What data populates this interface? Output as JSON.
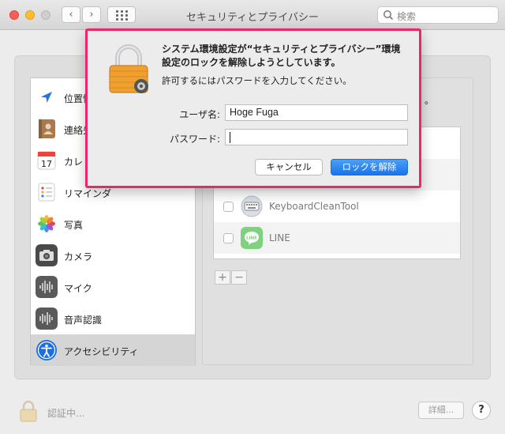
{
  "window": {
    "title": "セキュリティとプライバシー",
    "search_placeholder": "検索"
  },
  "sidebar": {
    "items": [
      {
        "label": "位置情",
        "icon": "location-arrow-icon"
      },
      {
        "label": "連絡先",
        "icon": "contacts-book-icon"
      },
      {
        "label": "カレ",
        "icon": "calendar-icon",
        "day": "17"
      },
      {
        "label": "リマインダ",
        "icon": "reminders-icon"
      },
      {
        "label": "写真",
        "icon": "photos-icon"
      },
      {
        "label": "カメラ",
        "icon": "camera-icon"
      },
      {
        "label": "マイク",
        "icon": "microphone-icon"
      },
      {
        "label": "音声認識",
        "icon": "speech-recognition-icon"
      },
      {
        "label": "アクセシビリティ",
        "icon": "accessibility-icon",
        "selected": true
      }
    ]
  },
  "app_list": [
    {
      "label": "KeyboardCleanTool",
      "icon": "keyboard-icon"
    },
    {
      "label": "LINE",
      "icon": "line-app-icon"
    }
  ],
  "right_text_fragment": "。",
  "list_controls": {
    "add": "+",
    "remove": "−"
  },
  "bottom": {
    "auth_label": "認証中...",
    "details_label": "詳細...",
    "help_label": "?"
  },
  "dialog": {
    "message": "システム環境設定が“セキュリティとプライバシー”環境設定のロックを解除しようとしています。",
    "instruction": "許可するにはパスワードを入力してください。",
    "username_label": "ユーザ名:",
    "username_value": "Hoge Fuga",
    "password_label": "パスワード:",
    "password_value": "",
    "cancel_label": "キャンセル",
    "unlock_label": "ロックを解除"
  },
  "colors": {
    "highlight_border": "#e8286d",
    "primary_button": "#1a74ea"
  }
}
